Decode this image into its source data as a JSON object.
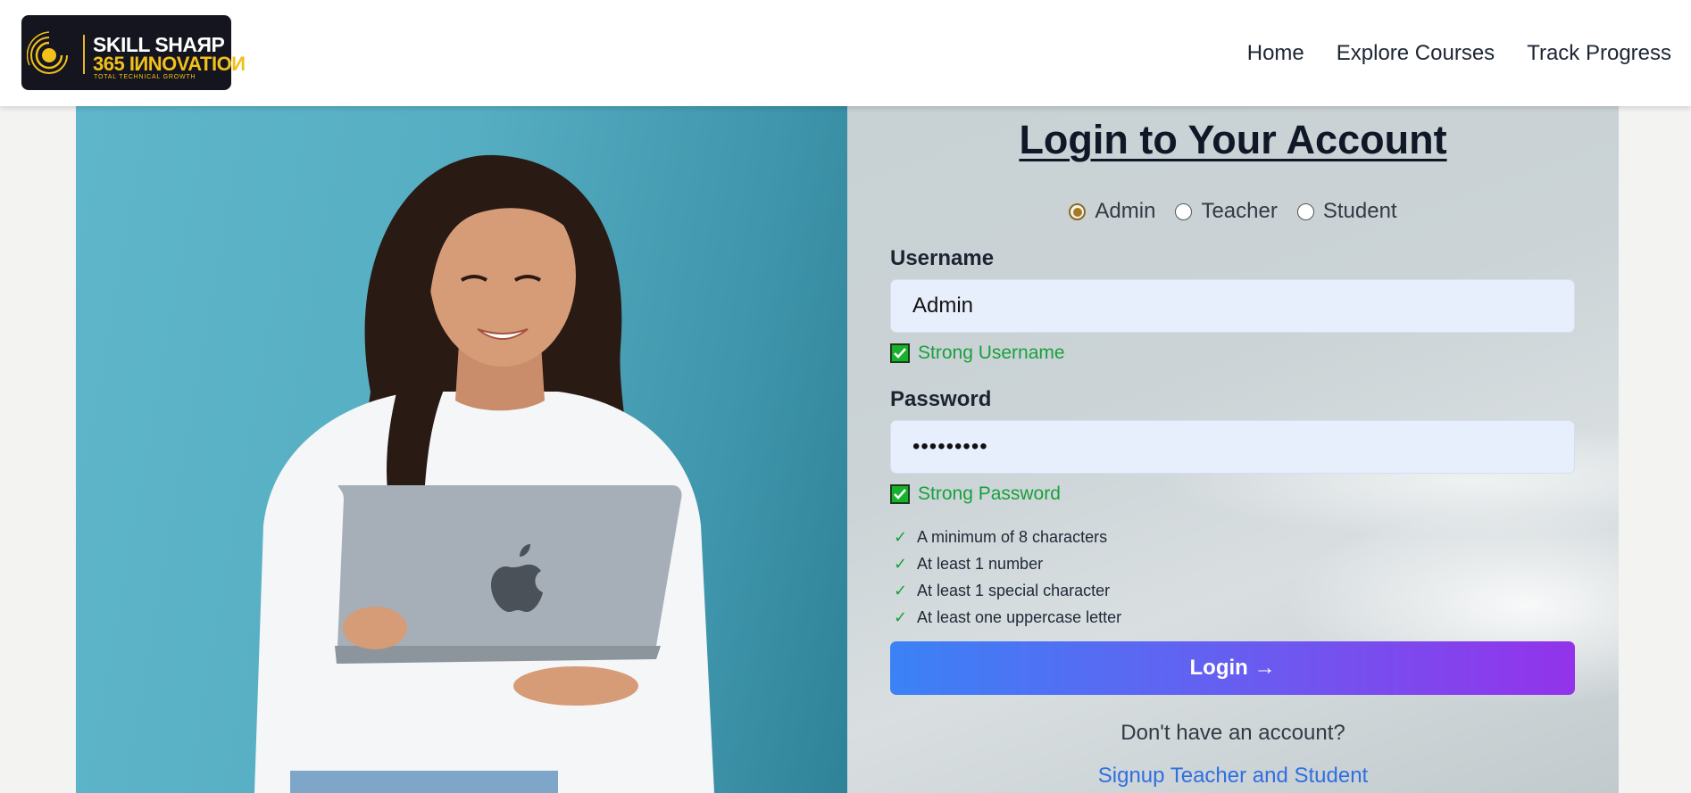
{
  "header": {
    "logo": {
      "line1": "SKILL SHAЯP",
      "line2": "365 IИNOVATIOИ",
      "line3": "TOTAL TECHNICAL GROWTH"
    },
    "nav": [
      {
        "label": "Home"
      },
      {
        "label": "Explore Courses"
      },
      {
        "label": "Track Progress"
      }
    ]
  },
  "login": {
    "title": "Login to Your Account",
    "roles": [
      {
        "label": "Admin",
        "checked": true
      },
      {
        "label": "Teacher",
        "checked": false
      },
      {
        "label": "Student",
        "checked": false
      }
    ],
    "username": {
      "label": "Username",
      "value": "Admin",
      "status": "Strong Username"
    },
    "password": {
      "label": "Password",
      "value": "•••••••••",
      "status": "Strong Password",
      "rules": [
        "A minimum of 8 characters",
        "At least 1 number",
        "At least 1 special character",
        "At least one uppercase letter"
      ]
    },
    "button_label": "Login →",
    "no_account_text": "Don't have an account?",
    "signup_link": "Signup Teacher and Student"
  },
  "colors": {
    "accent_start": "#3b82f6",
    "accent_end": "#9333ea",
    "success": "#19a03d",
    "link": "#2f6fe0",
    "photo_background": "#56aec3"
  }
}
